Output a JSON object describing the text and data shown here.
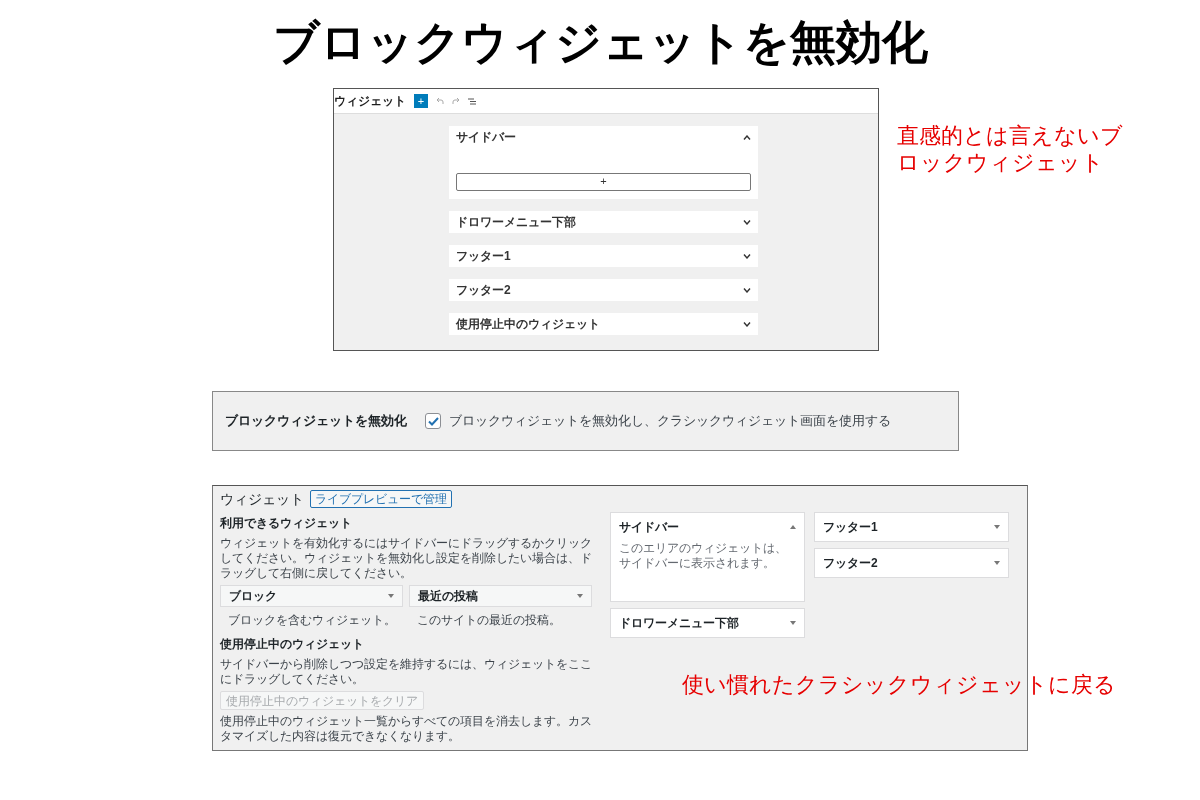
{
  "title": "ブロックウィジェットを無効化",
  "editor": {
    "title": "ウィジェット",
    "add_symbol": "+",
    "areas": [
      {
        "label": "サイドバー",
        "expanded": true
      },
      {
        "label": "ドロワーメニュー下部",
        "expanded": false
      },
      {
        "label": "フッター1",
        "expanded": false
      },
      {
        "label": "フッター2",
        "expanded": false
      },
      {
        "label": "使用停止中のウィジェット",
        "expanded": false
      }
    ]
  },
  "annotation_top": "直感的とは言えないブロックウィジェット",
  "setting": {
    "label": "ブロックウィジェットを無効化",
    "checkbox": {
      "label": "ブロックウィジェットを無効化し、クラシックウィジェット画面を使用する",
      "checked": true
    }
  },
  "classic": {
    "title": "ウィジェット",
    "preview_button": "ライブプレビューで管理",
    "available": {
      "heading": "利用できるウィジェット",
      "description": "ウィジェットを有効化するにはサイドバーにドラッグするかクリックしてください。ウィジェットを無効化し設定を削除したい場合は、ドラッグして右側に戻してください。",
      "widgets": [
        {
          "name": "ブロック",
          "description": "ブロックを含むウィジェット。"
        },
        {
          "name": "最近の投稿",
          "description": "このサイトの最近の投稿。"
        }
      ]
    },
    "inactive": {
      "heading": "使用停止中のウィジェット",
      "description": "サイドバーから削除しつつ設定を維持するには、ウィジェットをここにドラッグしてください。",
      "clear_button": {
        "label": "使用停止中のウィジェットをクリア",
        "disabled": true
      },
      "note": "使用停止中のウィジェット一覧からすべての項目を消去します。カスタマイズした内容は復元できなくなります。"
    },
    "area_columns": [
      {
        "areas": [
          {
            "name": "サイドバー",
            "expanded": true,
            "description": "このエリアのウィジェットは、サイドバーに表示されます。"
          },
          {
            "name": "ドロワーメニュー下部",
            "expanded": false
          }
        ]
      },
      {
        "areas": [
          {
            "name": "フッター1",
            "expanded": false
          },
          {
            "name": "フッター2",
            "expanded": false
          }
        ]
      }
    ]
  },
  "annotation_bottom": "使い慣れたクラシックウィジェットに戻る"
}
